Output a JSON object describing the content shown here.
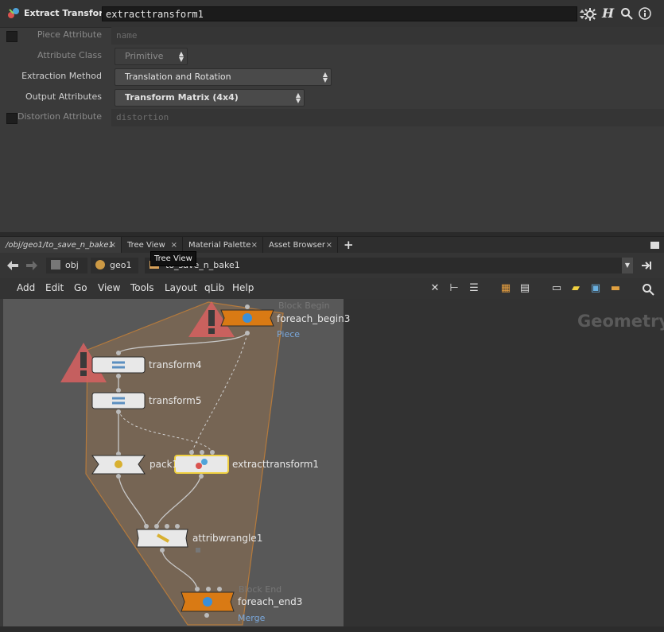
{
  "header": {
    "node_type": "Extract Transform",
    "node_name": "extracttransform1",
    "icons": [
      "gear-icon",
      "houdini-help-icon",
      "search-icon",
      "info-icon"
    ]
  },
  "params": {
    "piece_attribute": {
      "label": "Piece Attribute",
      "placeholder": "name"
    },
    "attribute_class": {
      "label": "Attribute Class",
      "value": "Primitive"
    },
    "extraction_method": {
      "label": "Extraction Method",
      "value": "Translation and Rotation"
    },
    "output_attributes": {
      "label": "Output Attributes",
      "value": "Transform Matrix (4x4)"
    },
    "distortion_attribute": {
      "label": "Distortion Attribute",
      "placeholder": "distortion"
    }
  },
  "tabs": [
    {
      "label": "/obj/geo1/to_save_n_bake1"
    },
    {
      "label": "Tree View"
    },
    {
      "label": "Material Palette"
    },
    {
      "label": "Asset Browser"
    }
  ],
  "tab_close": "×",
  "tab_add": "+",
  "path": {
    "obj": "obj",
    "geo": "geo1",
    "subnet": "to_save_n_bake1"
  },
  "tooltip": "Tree View",
  "menu": [
    "Add",
    "Edit",
    "Go",
    "View",
    "Tools",
    "Layout",
    "qLib",
    "Help"
  ],
  "network": {
    "context_label": "Geometry",
    "nodes": {
      "foreach_begin": {
        "name": "foreach_begin3",
        "faded": "Block Begin",
        "sub": "Piece"
      },
      "transform4": {
        "name": "transform4"
      },
      "transform5": {
        "name": "transform5"
      },
      "pack": {
        "name": "pack1"
      },
      "extract": {
        "name": "extracttransform1"
      },
      "wrangle": {
        "name": "attribwrangle1"
      },
      "foreach_end": {
        "name": "foreach_end3",
        "faded": "Block End",
        "sub": "Merge"
      }
    }
  },
  "colors": {
    "accent_orange": "#d97a14",
    "selected_yellow": "#f0d040",
    "warning_red": "#d86060"
  }
}
